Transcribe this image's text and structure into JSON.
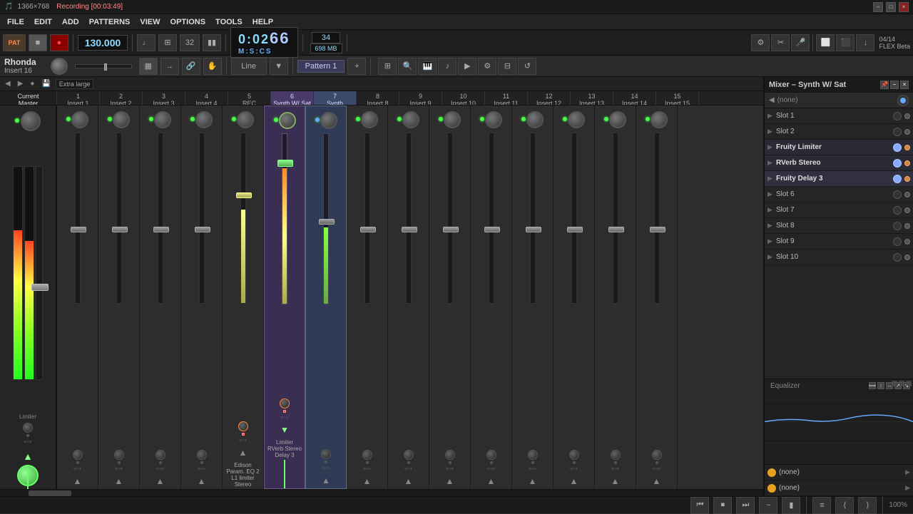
{
  "titlebar": {
    "resolution": "1366×768",
    "recording_time": "Recording [00:03:49]",
    "close": "×",
    "maximize": "□",
    "minimize": "–"
  },
  "menubar": {
    "items": [
      "FILE",
      "EDIT",
      "ADD",
      "PATTERNS",
      "VIEW",
      "OPTIONS",
      "TOOLS",
      "HELP"
    ]
  },
  "toolbar": {
    "bpm": "130.000",
    "beats": "32",
    "time_display": "0:02",
    "time_sub": "66",
    "time_prefix": "M:S:CS",
    "cpu": "34",
    "mem": "698 MB",
    "pat_label": "PAT",
    "flex_label": "FLEX Beta",
    "version": "04/14"
  },
  "toolbar2": {
    "channel_name": "Rhonda",
    "insert_label": "Insert 16",
    "pattern_btn": "Pattern 1",
    "line_label": "Line"
  },
  "nav_bar": {
    "zoom_label": "Extra large"
  },
  "mixer_panel": {
    "title": "Mixer – Synth W/ Sat",
    "channels": [
      {
        "id": "master",
        "label": "Master",
        "sub": "Master",
        "type": "master"
      },
      {
        "id": "1",
        "label": "1",
        "sub": "Insert 1"
      },
      {
        "id": "2",
        "label": "2",
        "sub": "Insert 2"
      },
      {
        "id": "3",
        "label": "3",
        "sub": "Insert 3"
      },
      {
        "id": "4",
        "label": "4",
        "sub": "Insert 4"
      },
      {
        "id": "5",
        "label": "5",
        "sub": "REC"
      },
      {
        "id": "6",
        "label": "6",
        "sub": "Synth W/ Sat",
        "active": true
      },
      {
        "id": "7",
        "label": "7",
        "sub": "Synth",
        "active2": true
      },
      {
        "id": "8",
        "label": "8",
        "sub": "Insert 8"
      },
      {
        "id": "9",
        "label": "9",
        "sub": "Insert 9"
      },
      {
        "id": "10",
        "label": "10",
        "sub": "Insert 10"
      },
      {
        "id": "11",
        "label": "11",
        "sub": "Insert 11"
      },
      {
        "id": "12",
        "label": "12",
        "sub": "Insert 12"
      },
      {
        "id": "13",
        "label": "13",
        "sub": "Insert 13"
      },
      {
        "id": "14",
        "label": "14",
        "sub": "Insert 14"
      },
      {
        "id": "15",
        "label": "15",
        "sub": "Insert 15"
      }
    ]
  },
  "right_panel": {
    "title": "Mixer – Synth W/ Sat",
    "none_label": "(none)",
    "slots": [
      {
        "id": "slot1",
        "label": "Slot 1",
        "has_plugin": false
      },
      {
        "id": "slot2",
        "label": "Slot 2",
        "has_plugin": false
      },
      {
        "id": "fruity_limiter",
        "label": "Fruity Limiter",
        "has_plugin": true
      },
      {
        "id": "rverb_stereo",
        "label": "RVerb Stereo",
        "has_plugin": true
      },
      {
        "id": "fruity_delay3",
        "label": "Fruity Delay 3",
        "has_plugin": true
      },
      {
        "id": "slot6",
        "label": "Slot 6",
        "has_plugin": false
      },
      {
        "id": "slot7",
        "label": "Slot 7",
        "has_plugin": false
      },
      {
        "id": "slot8",
        "label": "Slot 8",
        "has_plugin": false
      },
      {
        "id": "slot9",
        "label": "Slot 9",
        "has_plugin": false
      },
      {
        "id": "slot10",
        "label": "Slot 10",
        "has_plugin": false
      }
    ],
    "equalizer_label": "Equalizer",
    "bottom_slots": [
      {
        "label": "(none)"
      },
      {
        "label": "(none)"
      }
    ]
  },
  "plug_tooltip": {
    "line1": "Edison",
    "line2": "Param. EQ 2",
    "line3": "L1 limiter Stereo",
    "line4": "Limiter",
    "line5": "RVerb Stereo",
    "line6": "Delay 3"
  },
  "channel_labels": {
    "master_bottom": "Limiter"
  },
  "statusbar": {
    "zoom": "100%"
  }
}
